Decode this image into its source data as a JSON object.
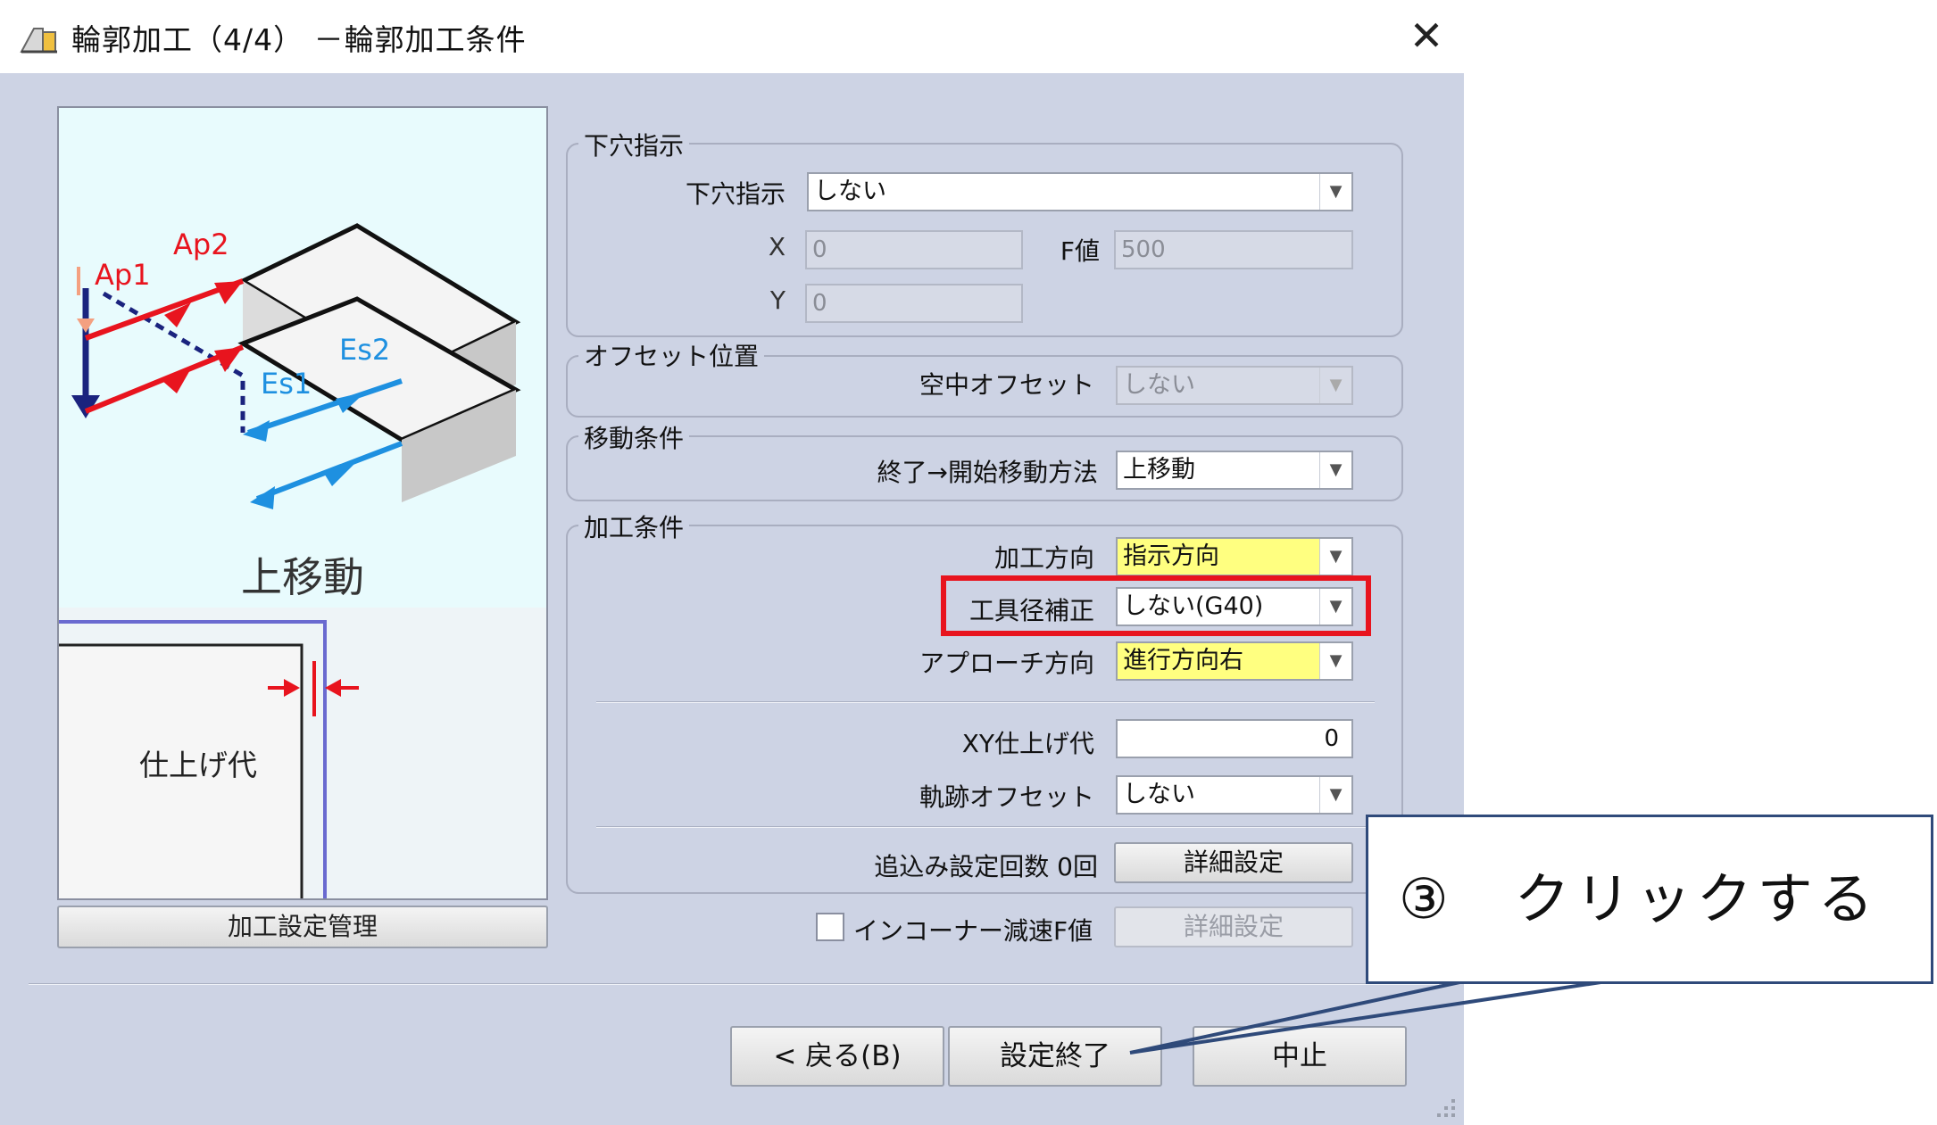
{
  "window": {
    "title": "輪郭加工（4/4） －輪郭加工条件",
    "close_glyph": "✕"
  },
  "preview": {
    "labels": {
      "ap1": "Ap1",
      "ap2": "Ap2",
      "es1": "Es1",
      "es2": "Es2"
    },
    "caption": "上移動",
    "finish_allowance_label": "仕上げ代",
    "manage_button": "加工設定管理"
  },
  "groups": {
    "pilot_hole": {
      "title": "下穴指示",
      "label": "下穴指示",
      "value": "しない",
      "x_label": "X",
      "x_value": "0",
      "y_label": "Y",
      "y_value": "0",
      "f_label": "F値",
      "f_value": "500"
    },
    "offset_position": {
      "title": "オフセット位置",
      "label": "空中オフセット",
      "value": "しない"
    },
    "move_condition": {
      "title": "移動条件",
      "label": "終了→開始移動方法",
      "value": "上移動"
    },
    "machining_condition": {
      "title": "加工条件",
      "direction_label": "加工方向",
      "direction_value": "指示方向",
      "tool_comp_label": "工具径補正",
      "tool_comp_value": "しない(G40)",
      "approach_label": "アプローチ方向",
      "approach_value": "進行方向右",
      "xy_allowance_label": "XY仕上げ代",
      "xy_allowance_value": "0",
      "trace_offset_label": "軌跡オフセット",
      "trace_offset_value": "しない",
      "chase_label": "追込み設定回数 0回",
      "detail_button": "詳細設定"
    }
  },
  "corner": {
    "label": "インコーナー減速F値",
    "detail_button": "詳細設定",
    "checked": false
  },
  "footer": {
    "back_button": "< 戻る(B)",
    "finish_button": "設定終了",
    "cancel_button": "中止"
  },
  "callout": {
    "text": "③　クリックする",
    "border_color": "#2f4a7a"
  },
  "colors": {
    "dialog_bg": "#cdd3e4",
    "highlight": "#e8141e",
    "yellow_field": "#ffff80",
    "arrow_red": "#e8141e",
    "arrow_blue": "#1e90e0",
    "arrow_navy": "#1a237e"
  }
}
